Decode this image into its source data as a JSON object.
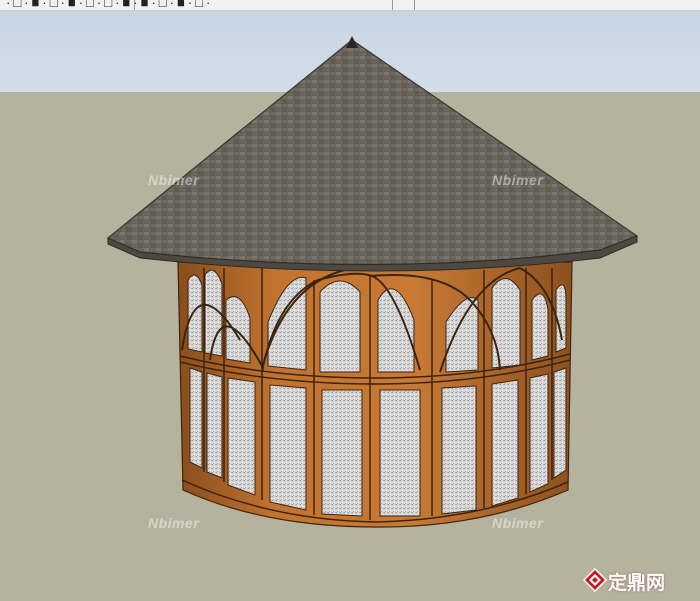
{
  "window": {
    "toolbar_text": "·□·■·□·■·□·□·■·■·□·■·□·"
  },
  "model": {
    "name": "gazebo-model",
    "roof_color": "#6f6860",
    "wall_color": "#b66a2a",
    "frame_color": "#a85e22",
    "glass_color": "#d4d4d4"
  },
  "watermarks": [
    {
      "text": "Nbimer"
    },
    {
      "text": "Nbimer"
    },
    {
      "text": "Nbimer"
    },
    {
      "text": "Nbimer"
    }
  ],
  "brand": {
    "text": "定鼎网",
    "color": "#c8191f"
  }
}
